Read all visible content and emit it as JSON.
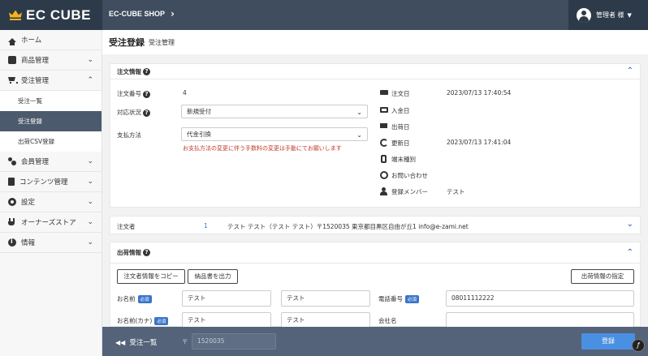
{
  "header": {
    "logo_text": "EC CUBE",
    "shop_name": "EC-CUBE SHOP",
    "shop_chevron": "›",
    "user_name": "管理者 様",
    "user_caret": "▼"
  },
  "sidebar": {
    "items": [
      {
        "label": "ホーム",
        "icon": "home-icon"
      },
      {
        "label": "商品管理",
        "icon": "product-icon",
        "chevron": "⌄"
      },
      {
        "label": "受注管理",
        "icon": "cart-icon",
        "chevron": "⌃"
      },
      {
        "label": "会員管理",
        "icon": "users-icon",
        "chevron": "⌄"
      },
      {
        "label": "コンテンツ管理",
        "icon": "file-icon",
        "chevron": "⌄"
      },
      {
        "label": "設定",
        "icon": "gear-icon",
        "chevron": "⌄"
      },
      {
        "label": "オーナーズストア",
        "icon": "plug-icon",
        "chevron": "⌄"
      },
      {
        "label": "情報",
        "icon": "info-icon",
        "chevron": "⌄"
      }
    ],
    "sub_items": [
      "受注一覧",
      "受注登録",
      "出荷CSV登録"
    ]
  },
  "page": {
    "title": "受注登録",
    "subtitle": "受注管理"
  },
  "order_info": {
    "heading": "注文情報",
    "help": "?",
    "collapse": "⌃",
    "order_no_label": "注文番号",
    "order_no": "4",
    "status_label": "対応状況",
    "status_value": "新規受付",
    "payment_label": "支払方法",
    "payment_value": "代金引換",
    "select_caret": "⌄",
    "warning": "お支払方法の変更に伴う手数料の変更は手動にてお願いします",
    "order_date_label": "注文日",
    "order_date": "2023/07/13 17:40:54",
    "payment_date_label": "入金日",
    "ship_date_label": "出荷日",
    "updated_label": "更新日",
    "updated": "2023/07/13 17:41:04",
    "device_label": "端末種別",
    "inquiry_label": "お問い合わせ",
    "member_label": "登録メンバー",
    "member_value": "テスト"
  },
  "orderer": {
    "label": "注文者",
    "count": "1",
    "summary": "テスト テスト（テスト テスト）〒1520035 東京都目黒区自由が丘1 info@e-zami.net",
    "expand": "⌄"
  },
  "shipping": {
    "heading": "出荷情報",
    "help": "?",
    "collapse": "⌃",
    "copy_button": "注文者情報をコピー",
    "output_button": "納品書を出力",
    "specify_button": "出荷情報の指定",
    "name_label": "お名前",
    "kana_label": "お名前(カナ)",
    "required": "必須",
    "name_sei": "テスト",
    "name_mei": "テスト",
    "kana_sei": "テスト",
    "kana_mei": "テスト",
    "phone_label": "電話番号",
    "phone": "08011112222",
    "company_label": "会社名",
    "zip_prefix": "〒",
    "zip": "1520035"
  },
  "footer": {
    "back_arrow": "◀◀",
    "back_label": "受注一覧",
    "register": "登録"
  },
  "fab": "ƒ"
}
